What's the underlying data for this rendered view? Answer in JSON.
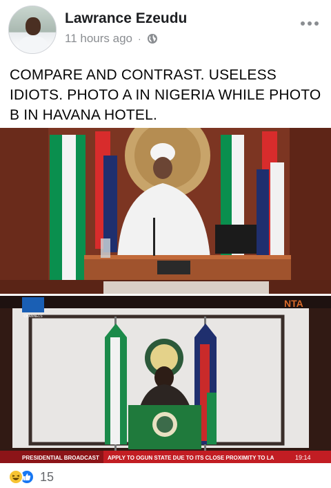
{
  "post": {
    "author": "Lawrance Ezeudu",
    "time": "11 hours ago",
    "separator": "·",
    "privacy_icon": "globe-icon",
    "more_icon": "more-options-icon",
    "text": "COMPARE AND CONTRAST. USELESS IDIOTS. PHOTO A IN NIGERIA WHILE PHOTO B IN HAVANA HOTEL."
  },
  "broadcast": {
    "logo_left": "CHANNELS",
    "logo_right": "NTA",
    "title": "PRESIDENTIAL BROADCAST",
    "ticker": "APPLY TO OGUN STATE DUE TO ITS CLOSE PROXIMITY TO LA",
    "clock": "19:14"
  },
  "reactions": {
    "icons": [
      "haha-icon",
      "like-icon"
    ],
    "count": "15"
  },
  "colors": {
    "meta_gray": "#8a8d91",
    "like_blue": "#1877f2",
    "haha_yellow": "#f7c433",
    "flag_green": "#008751"
  }
}
